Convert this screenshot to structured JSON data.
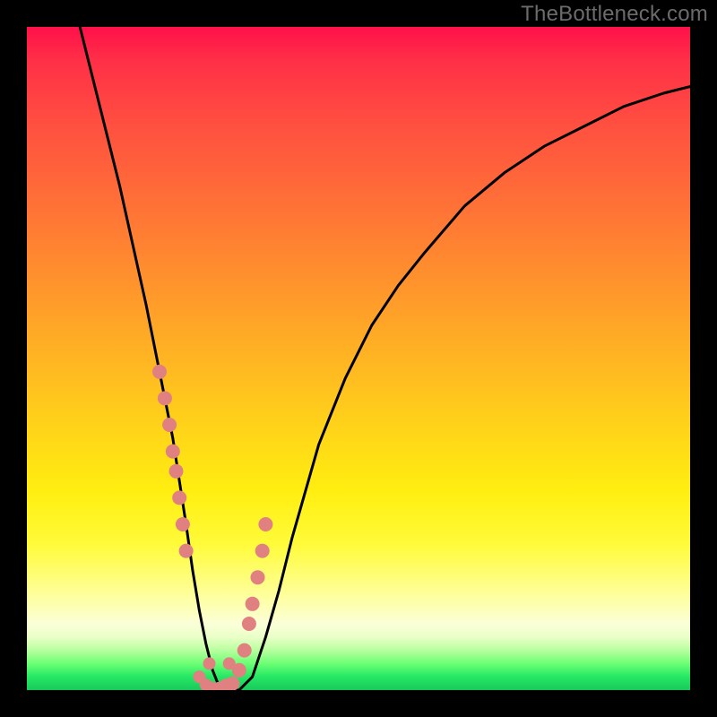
{
  "watermark": {
    "text": "TheBottleneck.com"
  },
  "colors": {
    "page_bg": "#000000",
    "curve": "#000000",
    "dots": "#e08080",
    "gradient_top": "#ff104a",
    "gradient_mid": "#ffd21a",
    "gradient_bottom": "#19c95b"
  },
  "chart_data": {
    "type": "line",
    "title": "",
    "xlabel": "",
    "ylabel": "",
    "xlim": [
      0,
      100
    ],
    "ylim": [
      0,
      100
    ],
    "grid": false,
    "legend": false,
    "series": [
      {
        "name": "bottleneck-curve",
        "x": [
          8,
          10,
          12,
          14,
          16,
          18,
          20,
          22,
          24,
          25,
          26,
          27,
          28,
          29,
          30,
          32,
          34,
          36,
          38,
          40,
          44,
          48,
          52,
          56,
          60,
          66,
          72,
          78,
          84,
          90,
          96,
          100
        ],
        "y": [
          100,
          92,
          84,
          76,
          67,
          58,
          48,
          38,
          25,
          18,
          12,
          7,
          3,
          0.5,
          0,
          0,
          2,
          8,
          15,
          23,
          37,
          47,
          55,
          61,
          66,
          73,
          78,
          82,
          85,
          88,
          90,
          91
        ]
      }
    ],
    "annotations": {
      "dots_left_descent": [
        [
          20,
          48
        ],
        [
          20.8,
          44
        ],
        [
          21.5,
          40
        ],
        [
          22,
          36
        ],
        [
          22.5,
          33
        ],
        [
          23,
          29
        ],
        [
          23.5,
          25
        ],
        [
          24,
          21
        ]
      ],
      "dots_right_ascent": [
        [
          31,
          1
        ],
        [
          32,
          3
        ],
        [
          32.8,
          6
        ],
        [
          33.5,
          10
        ],
        [
          34,
          13
        ],
        [
          34.8,
          17
        ],
        [
          35.5,
          21
        ],
        [
          36,
          25
        ]
      ],
      "dots_valley_floor": [
        [
          26,
          2
        ],
        [
          27,
          0.8
        ],
        [
          28,
          0.3
        ],
        [
          29,
          0.3
        ],
        [
          30,
          0.8
        ],
        [
          27.5,
          4
        ],
        [
          30.5,
          4
        ]
      ]
    }
  }
}
